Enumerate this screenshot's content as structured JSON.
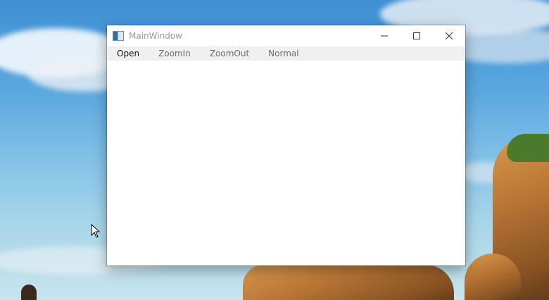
{
  "window": {
    "title": "MainWindow",
    "controls": {
      "minimize": "minimize-icon",
      "maximize": "maximize-icon",
      "close": "close-icon"
    }
  },
  "menu": {
    "items": [
      {
        "label": "Open",
        "enabled": true
      },
      {
        "label": "ZoomIn",
        "enabled": false
      },
      {
        "label": "ZoomOut",
        "enabled": false
      },
      {
        "label": "Normal",
        "enabled": false
      }
    ]
  },
  "colors": {
    "menubar_bg": "#f0f0f0",
    "disabled_text": "#6b6b6b",
    "enabled_text": "#111111",
    "title_text": "#9a9a9a"
  }
}
